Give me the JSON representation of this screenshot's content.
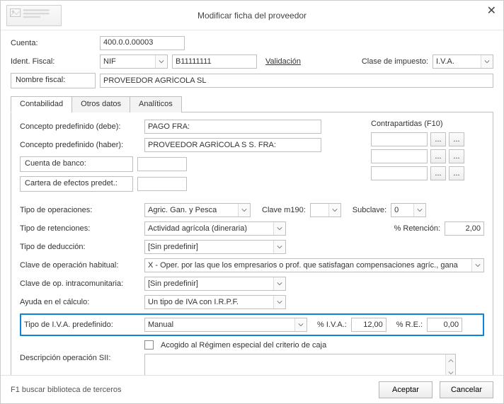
{
  "titlebar": {
    "title": "Modificar ficha del proveedor"
  },
  "header": {
    "cuenta_label": "Cuenta:",
    "cuenta_value": "400.0.0.00003",
    "ident_label": "Ident. Fiscal:",
    "ident_type": "NIF",
    "ident_value": "B11111111",
    "validacion": "Validación",
    "clase_impuesto_label": "Clase de impuesto:",
    "clase_impuesto_value": "I.V.A.",
    "nombre_fiscal_label": "Nombre fiscal:",
    "nombre_fiscal_value": "PROVEEDOR AGRÍCOLA SL"
  },
  "tabs": {
    "t1": "Contabilidad",
    "t2": "Otros datos",
    "t3": "Analíticos"
  },
  "contab": {
    "concepto_debe_label": "Concepto predefinido (debe):",
    "concepto_debe_value": "PAGO FRA:",
    "concepto_haber_label": "Concepto predefinido (haber):",
    "concepto_haber_value": "PROVEEDOR AGRÍCOLA S S. FRA:",
    "contrapartidas_label": "Contrapartidas (F10)",
    "cuenta_banco_label": "Cuenta de banco:",
    "cartera_label": "Cartera de efectos predet.:",
    "tipo_oper_label": "Tipo de operaciones:",
    "tipo_oper_value": "Agric. Gan. y Pesca",
    "clave_m190_label": "Clave m190:",
    "clave_m190_value": "",
    "subclave_label": "Subclave:",
    "subclave_value": "0",
    "tipo_ret_label": "Tipo de retenciones:",
    "tipo_ret_value": "Actividad agrícola (dineraria)",
    "pct_ret_label": "% Retención:",
    "pct_ret_value": "2,00",
    "tipo_ded_label": "Tipo de deducción:",
    "tipo_ded_value": "[Sin predefinir]",
    "clave_op_hab_label": "Clave de operación habitual:",
    "clave_op_hab_value": "X - Oper. por las que los empresarios o prof. que satisfagan compensaciones agríc., gana",
    "clave_op_intra_label": "Clave de op. intracomunitaria:",
    "clave_op_intra_value": "[Sin predefinir]",
    "ayuda_calc_label": "Ayuda en el cálculo:",
    "ayuda_calc_value": "Un tipo de IVA con I.R.P.F.",
    "tipo_iva_pred_label": "Tipo de I.V.A. predefinido:",
    "tipo_iva_pred_value": "Manual",
    "pct_iva_label": "% I.V.A.:",
    "pct_iva_value": "12,00",
    "pct_re_label": "% R.E.:",
    "pct_re_value": "0,00",
    "acogido_label": "Acogido al Régimen especial del criterio de caja",
    "desc_sii_label": "Descripción operación SII:",
    "ellipsis": "..."
  },
  "footer": {
    "hint": "F1 buscar biblioteca de terceros",
    "ok": "Aceptar",
    "cancel": "Cancelar"
  }
}
